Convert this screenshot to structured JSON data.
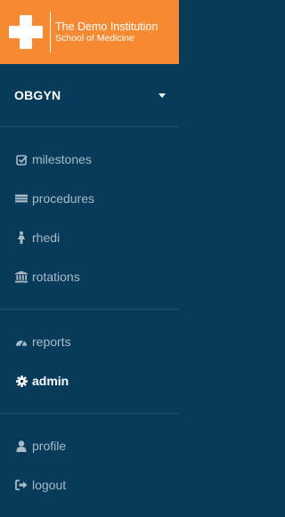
{
  "brand": {
    "title": "The Demo Institution",
    "subtitle": "School of Medicine",
    "logo_icon": "medical-cross-icon",
    "color": "#f58a33"
  },
  "program": {
    "label": "OBGYN",
    "icon": "caret-down-icon"
  },
  "nav_groups": [
    {
      "items": [
        {
          "label": "milestones",
          "icon": "check-square-icon"
        },
        {
          "label": "procedures",
          "icon": "procedures-icon"
        },
        {
          "label": "rhedi",
          "icon": "female-icon"
        },
        {
          "label": "rotations",
          "icon": "institution-icon"
        }
      ]
    },
    {
      "items": [
        {
          "label": "reports",
          "icon": "dashboard-icon"
        },
        {
          "label": "admin",
          "icon": "gear-icon",
          "active": true
        }
      ]
    },
    {
      "items": [
        {
          "label": "profile",
          "icon": "user-icon"
        },
        {
          "label": "logout",
          "icon": "sign-out-icon"
        }
      ]
    }
  ],
  "colors": {
    "sidebar_bg": "#083b5a",
    "item_text": "#a9bac6",
    "active_text": "#ffffff",
    "divider": "#1c5273"
  }
}
